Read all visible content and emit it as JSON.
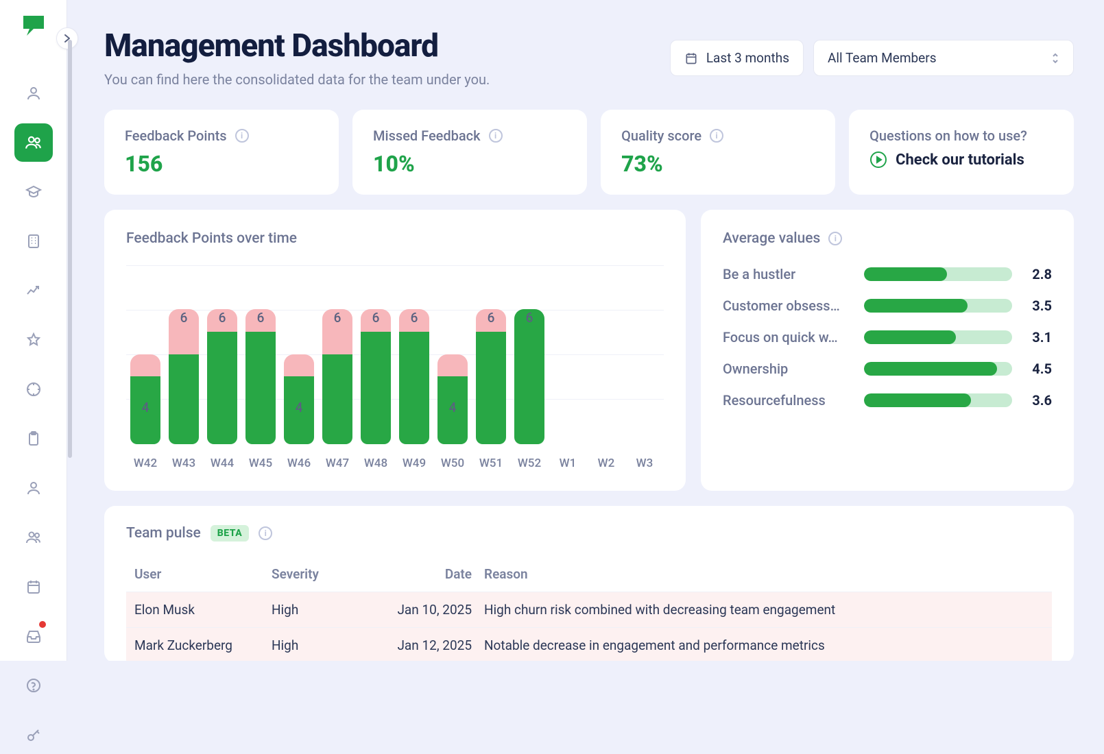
{
  "header": {
    "title": "Management Dashboard",
    "subtitle": "You can find here the consolidated data for the team under you.",
    "date_filter": "Last 3 months",
    "team_selector": "All Team Members"
  },
  "kpis": {
    "feedback_points": {
      "label": "Feedback Points",
      "value": "156"
    },
    "missed_feedback": {
      "label": "Missed Feedback",
      "value": "10%"
    },
    "quality_score": {
      "label": "Quality score",
      "value": "73%"
    }
  },
  "tutorials": {
    "question": "Questions on how to use?",
    "cta": "Check our tutorials"
  },
  "chart": {
    "title": "Feedback Points over time"
  },
  "chart_data": {
    "type": "bar",
    "categories": [
      "W42",
      "W43",
      "W44",
      "W45",
      "W46",
      "W47",
      "W48",
      "W49",
      "W50",
      "W51",
      "W52",
      "W1",
      "W2",
      "W3"
    ],
    "series": [
      {
        "name": "green",
        "values": [
          3,
          4,
          5,
          5,
          3,
          4,
          5,
          5,
          3,
          5,
          6,
          0,
          0,
          0
        ]
      },
      {
        "name": "pink",
        "values": [
          1,
          2,
          1,
          1,
          1,
          2,
          1,
          1,
          1,
          1,
          0,
          0,
          0,
          0
        ]
      }
    ],
    "totals": [
      4,
      6,
      6,
      6,
      4,
      6,
      6,
      6,
      4,
      6,
      6,
      null,
      null,
      null
    ],
    "ylim": [
      0,
      7
    ],
    "title": "Feedback Points over time",
    "xlabel": "",
    "ylabel": ""
  },
  "averages": {
    "title": "Average values",
    "max": 5,
    "items": [
      {
        "label": "Be a hustler",
        "value": 2.8
      },
      {
        "label": "Customer obsess…",
        "value": 3.5
      },
      {
        "label": "Focus on quick w…",
        "value": 3.1
      },
      {
        "label": "Ownership",
        "value": 4.5
      },
      {
        "label": "Resourcefulness",
        "value": 3.6
      }
    ]
  },
  "pulse": {
    "title": "Team pulse",
    "beta": "BETA",
    "columns": {
      "user": "User",
      "severity": "Severity",
      "date": "Date",
      "reason": "Reason"
    },
    "rows": [
      {
        "user": "Elon Musk",
        "severity": "High",
        "date": "Jan 10, 2025",
        "reason": "High churn risk combined with decreasing team engagement"
      },
      {
        "user": "Mark Zuckerberg",
        "severity": "High",
        "date": "Jan 12, 2025",
        "reason": "Notable decrease in engagement and performance metrics"
      }
    ]
  }
}
